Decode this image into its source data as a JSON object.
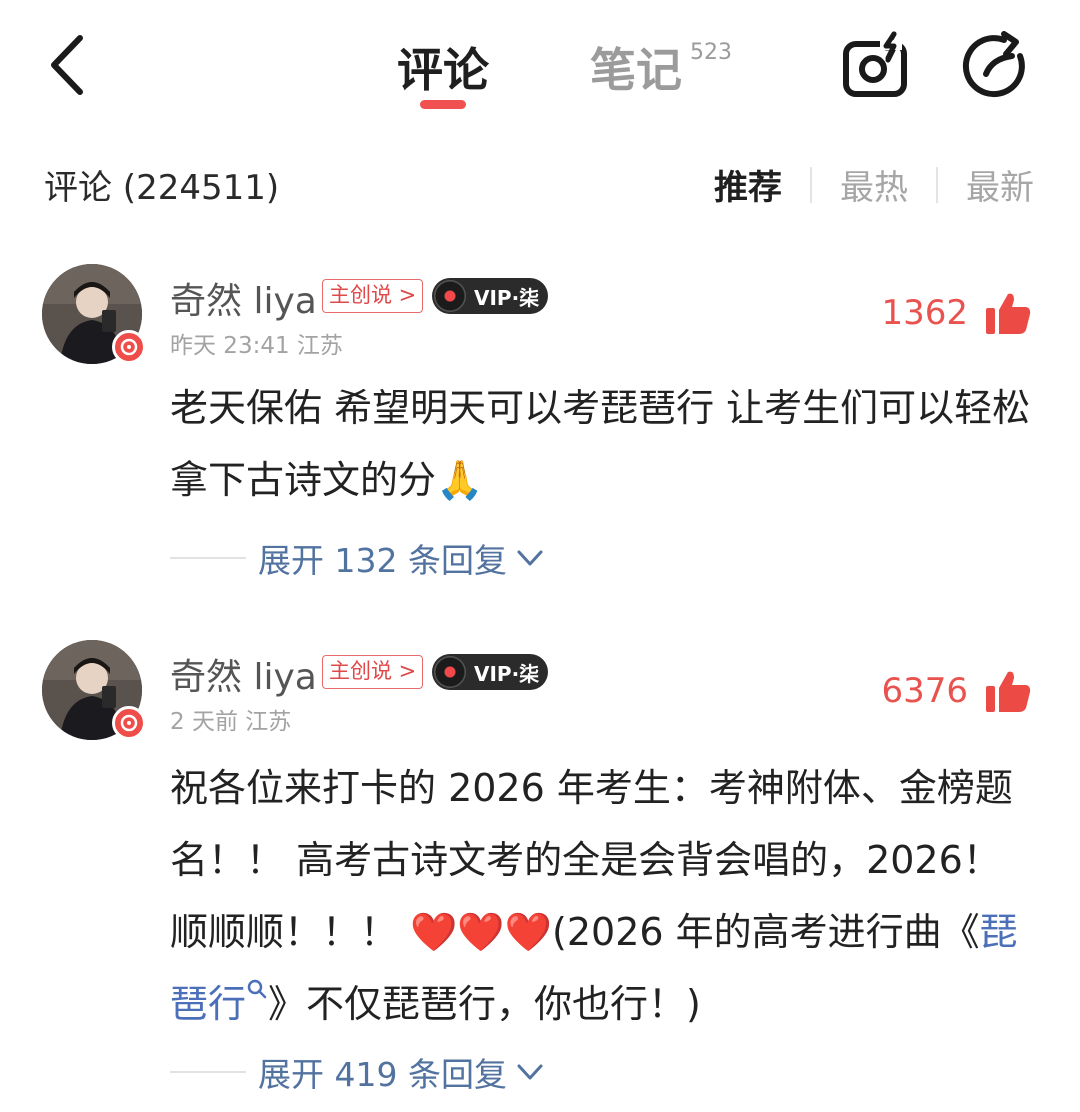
{
  "header": {
    "tabs": [
      {
        "label": "评论",
        "active": true
      },
      {
        "label": "笔记",
        "count": "523"
      }
    ],
    "accent_color": "#f0504f"
  },
  "comments_header": {
    "title": "评论 (224511)",
    "sort_options": [
      "推荐",
      "最热",
      "最新"
    ],
    "active_sort": "推荐"
  },
  "comments": [
    {
      "username": "奇然 liya",
      "creator_tag": "主创说 >",
      "vip_label": "VIP·柒",
      "meta": "昨天 23:41 江苏",
      "likes": "1362",
      "text": "老天保佑 希望明天可以考琵琶行 让考生们可以轻松拿下古诗文的分🙏",
      "reply_label": "展开 132 条回复"
    },
    {
      "username": "奇然 liya",
      "creator_tag": "主创说 >",
      "vip_label": "VIP·柒",
      "meta": "2 天前 江苏",
      "likes": "6376",
      "text_part1": "祝各位来打卡的 2026 年考生：考神附体、金榜题名！！ 高考古诗文考的全是会背会唱的，2026！ 顺顺顺！！！ ❤️❤️❤️(2026 年的高考进行曲《",
      "song_link": "琵琶行",
      "text_part2": "》不仅琵琶行，你也行！)",
      "reply_label": "展开 419 条回复"
    }
  ],
  "icons": {
    "back": "chevron-left-icon",
    "camera": "camera-flash-icon",
    "share": "share-refresh-icon",
    "like": "thumbs-up-icon",
    "search": "search-icon",
    "expand": "chevron-down-icon"
  }
}
